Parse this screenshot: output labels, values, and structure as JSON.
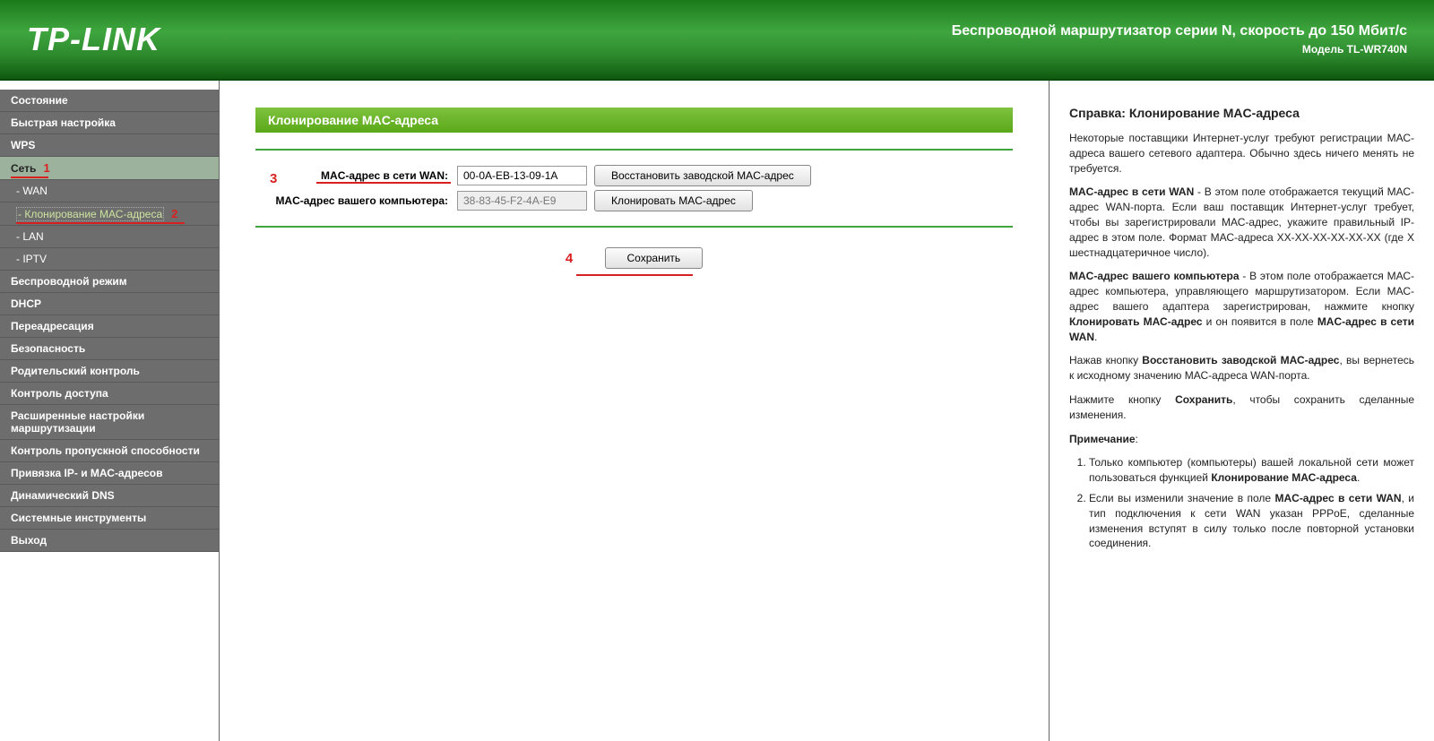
{
  "header": {
    "logo": "TP-LINK",
    "title": "Беспроводной маршрутизатор серии N, скорость до 150 Мбит/с",
    "model": "Модель TL-WR740N"
  },
  "sidebar": [
    {
      "label": "Состояние",
      "type": "item"
    },
    {
      "label": "Быстрая настройка",
      "type": "item"
    },
    {
      "label": "WPS",
      "type": "item"
    },
    {
      "label": "Сеть",
      "type": "parent",
      "active_parent": true,
      "annot": "1"
    },
    {
      "label": "- WAN",
      "type": "sub"
    },
    {
      "label": "- Клонирование МАС-адреса",
      "type": "sub",
      "active": true,
      "annot": "2"
    },
    {
      "label": "- LAN",
      "type": "sub"
    },
    {
      "label": "- IPTV",
      "type": "sub"
    },
    {
      "label": "Беспроводной режим",
      "type": "item"
    },
    {
      "label": "DHCP",
      "type": "item"
    },
    {
      "label": "Переадресация",
      "type": "item"
    },
    {
      "label": "Безопасность",
      "type": "item"
    },
    {
      "label": "Родительский контроль",
      "type": "item"
    },
    {
      "label": "Контроль доступа",
      "type": "item"
    },
    {
      "label": "Расширенные настройки маршрутизации",
      "type": "item"
    },
    {
      "label": "Контроль пропускной способности",
      "type": "item"
    },
    {
      "label": "Привязка IP- и МАС-адресов",
      "type": "item"
    },
    {
      "label": "Динамический DNS",
      "type": "item"
    },
    {
      "label": "Системные инструменты",
      "type": "item"
    },
    {
      "label": "Выход",
      "type": "item"
    }
  ],
  "main": {
    "panel_title": "Клонирование MAC-адреса",
    "row1": {
      "label": "MAC-адрес в сети WAN:",
      "value": "00-0A-EB-13-09-1A",
      "button": "Восстановить заводской MAC-адрес",
      "annot": "3"
    },
    "row2": {
      "label": "MAC-адрес вашего компьютера:",
      "value": "38-83-45-F2-4A-E9",
      "button": "Клонировать MAC-адрес"
    },
    "save": {
      "label": "Сохранить",
      "annot": "4"
    }
  },
  "help": {
    "title": "Справка: Клонирование MAC-адреса",
    "p1": "Некоторые поставщики Интернет-услуг требуют регистрации МАС-адреса вашего сетевого адаптера. Обычно здесь ничего менять не требуется.",
    "p2a": "MAC-адрес в сети WAN",
    "p2b": " - В этом поле отображается текущий МАС-адрес WAN-порта. Если ваш поставщик Интернет-услуг требует, чтобы вы зарегистрировали МАС-адрес, укажите правильный IP-адрес в этом поле. Формат МАС-адреса XX-XX-XX-XX-XX-XX (где X шестнадцатеричное число).",
    "p3a": "MAC-адрес вашего компьютера",
    "p3b": " - В этом поле отображается МАС-адрес компьютера, управляющего маршрутизатором. Если МАС-адрес вашего адаптера зарегистрирован, нажмите кнопку ",
    "p3c": "Клонировать МАС-адрес",
    "p3d": " и он появится в поле ",
    "p3e": "MAC-адрес в сети WAN",
    "p3f": ".",
    "p4a": "Нажав кнопку ",
    "p4b": "Восстановить заводской МАС-адрес",
    "p4c": ", вы вернетесь к исходному значению МАС-адреса WAN-порта.",
    "p5a": "Нажмите кнопку ",
    "p5b": "Сохранить",
    "p5c": ", чтобы сохранить сделанные изменения.",
    "note_label": "Примечание",
    "li1a": "Только компьютер (компьютеры) вашей локальной сети может пользоваться функцией ",
    "li1b": "Клонирование МАС-адреса",
    "li1c": ".",
    "li2a": "Если вы изменили значение в поле ",
    "li2b": "MAC-адрес в сети WAN",
    "li2c": ", и тип подключения к сети WAN указан PPPoE, сделанные изменения вступят в силу только после повторной установки соединения."
  }
}
